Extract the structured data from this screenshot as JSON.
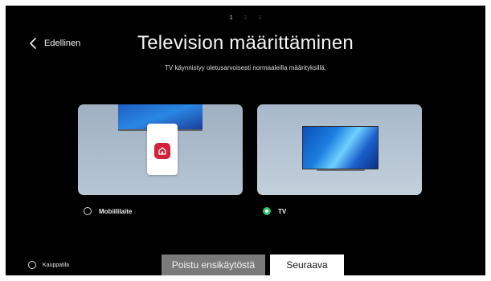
{
  "steps": [
    "1",
    "2",
    "3"
  ],
  "nav": {
    "back_label": "Edellinen"
  },
  "header": {
    "title": "Television määrittäminen",
    "subtitle": "TV käynnistyy oletusarvoisesti normaaleilla määrityksillä."
  },
  "options": [
    {
      "label": "Mobiililaite",
      "selected": false
    },
    {
      "label": "TV",
      "selected": true
    }
  ],
  "footer": {
    "store_mode_label": "Kauppatila",
    "exit_label": "Poistu ensikäytöstä",
    "next_label": "Seuraava"
  },
  "colors": {
    "background": "#000000",
    "selected_radio": "#2ec06b",
    "app_icon": "#d2213a",
    "exit_button": "#7a7a7a",
    "next_button": "#ffffff"
  },
  "icons": [
    "chevron-left-icon",
    "home-app-icon"
  ]
}
